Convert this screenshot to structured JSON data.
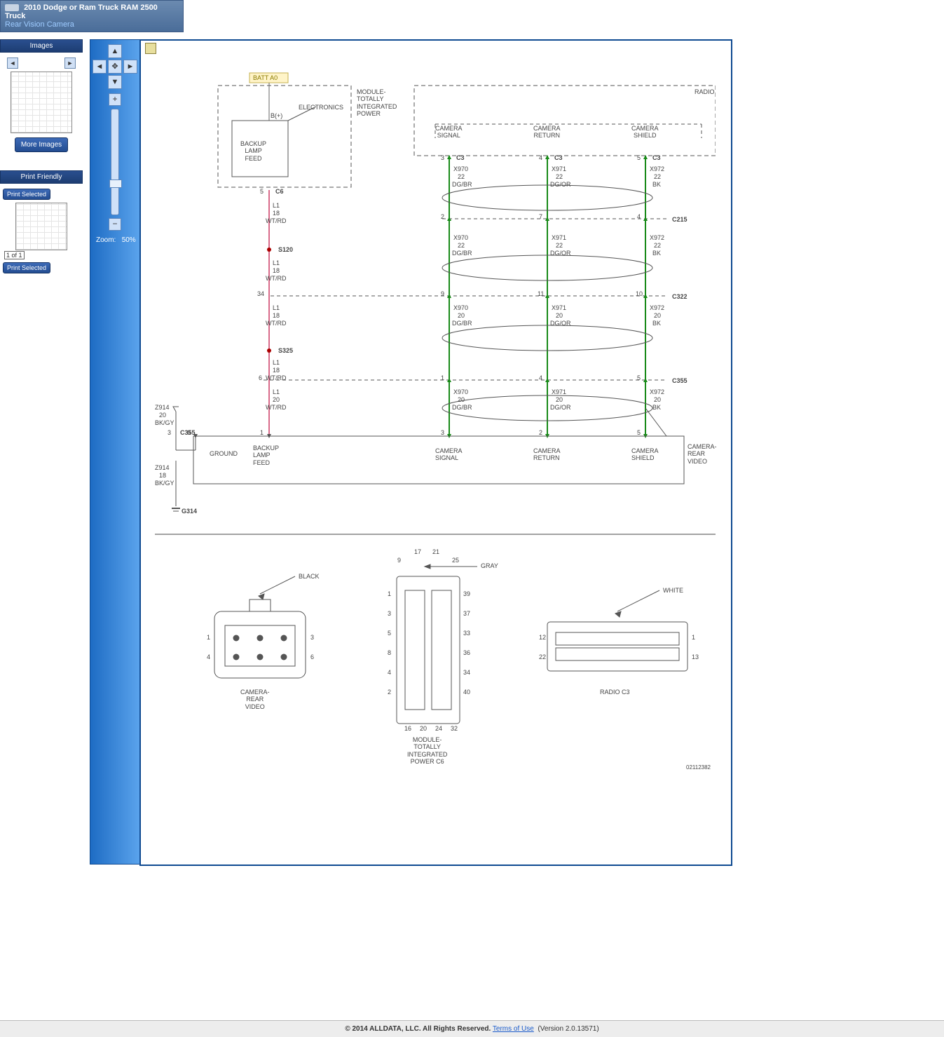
{
  "header": {
    "title": "2010 Dodge or Ram Truck RAM 2500 Truck",
    "subtitle": "Rear Vision Camera"
  },
  "left": {
    "images_hd": "Images",
    "more_images": "More Images",
    "print_hd": "Print Friendly",
    "print_sel": "Print Selected",
    "caption": "1 of 1"
  },
  "zoom": {
    "label": "Zoom:",
    "value": "50%"
  },
  "diagram": {
    "batt": "BATT A0",
    "bplus": "B(+)",
    "electronics": "ELECTRONICS",
    "module_tipm": "MODULE-\nTOTALLY\nINTEGRATED\nPOWER",
    "backup_feed": "BACKUP\nLAMP\nFEED",
    "radio": "RADIO",
    "cam_signal": "CAMERA\nSIGNAL",
    "cam_return": "CAMERA\nRETURN",
    "cam_shield": "CAMERA\nSHIELD",
    "c3_1": "3",
    "c3_2": "4",
    "c3_3": "5",
    "c3": "C3",
    "x970": "X970",
    "x971": "X971",
    "x972": "X972",
    "g22": "22",
    "g20": "20",
    "g18": "18",
    "dgbr": "DG/BR",
    "dgor": "DG/OR",
    "bk": "BK",
    "c215": "C215",
    "c322": "C322",
    "c355": "C355",
    "c215_1": "2",
    "c215_2": "7",
    "c215_3": "4",
    "c322_1": "9",
    "c322_2": "11",
    "c322_3": "10",
    "c355_1": "1",
    "c355_2": "4",
    "c355_3": "5",
    "c6": "C6",
    "c6pin": "5",
    "c322pin34": "34",
    "c355pin6": "6",
    "l1": "L1",
    "wtrd": "WT/RD",
    "s120": "S120",
    "s325": "S325",
    "z914": "Z914",
    "bkgy": "BK/GY",
    "zpin3": "3",
    "zpin6": "6",
    "zpin1": "1",
    "g314": "G314",
    "ground": "GROUND",
    "crv": "CAMERA-\nREAR\nVIDEO",
    "cr_ground": "GROUND",
    "cr_feed": "BACKUP\nLAMP\nFEED",
    "cr_sig": "CAMERA\nSIGNAL",
    "cr_ret": "CAMERA\nRETURN",
    "cr_shd": "CAMERA\nSHIELD",
    "c355b_1": "3",
    "c355b_2": "2",
    "c355b_3": "5",
    "pins_left": {
      "black": "BLACK",
      "1": "1",
      "3": "3",
      "4": "4",
      "6": "6",
      "name": "CAMERA-\nREAR\nVIDEO"
    },
    "pins_mid": {
      "gray": "GRAY",
      "9": "9",
      "17": "17",
      "21": "21",
      "25": "25",
      "1": "1",
      "39": "39",
      "3": "3",
      "37": "37",
      "5": "5",
      "33": "33",
      "8": "8",
      "36": "36",
      "4": "4",
      "34": "34",
      "2": "2",
      "40": "40",
      "16": "16",
      "20": "20",
      "24": "24",
      "32": "32",
      "name": "MODULE-\nTOTALLY\nINTEGRATED\nPOWER C6"
    },
    "pins_right": {
      "white": "WHITE",
      "12": "12",
      "1": "1",
      "22": "22",
      "13": "13",
      "name": "RADIO C3"
    },
    "docnum": "02112382"
  },
  "footer": {
    "copyright": "© 2014 ALLDATA, LLC. All Rights Reserved.",
    "terms": "Terms of Use",
    "version": "(Version 2.0.13571)"
  }
}
